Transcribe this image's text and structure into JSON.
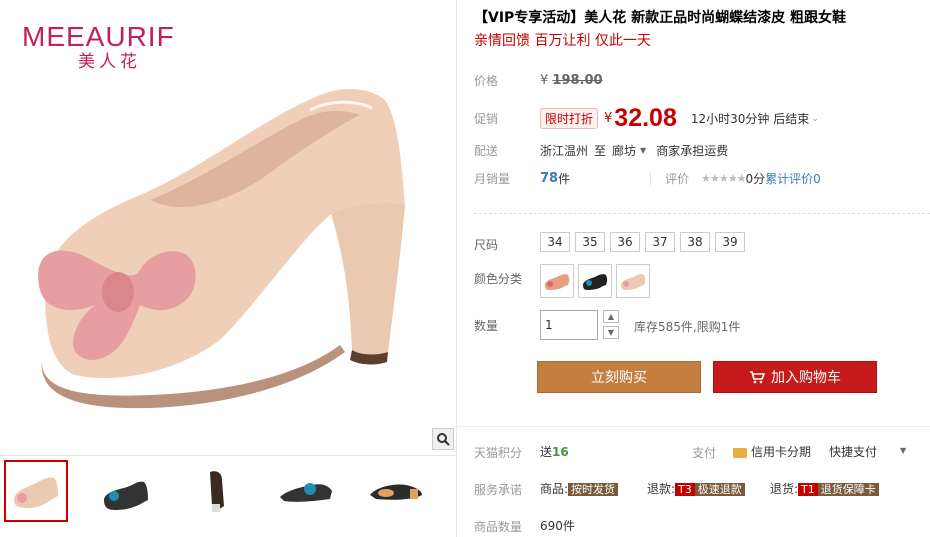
{
  "brand": {
    "name_en": "MEEAURIF",
    "name_cn": "美人花"
  },
  "thumbnails": [
    "thumb-pink-pump",
    "thumb-black-blue-side",
    "thumb-black-back",
    "thumb-blue-side",
    "thumb-sole"
  ],
  "title": "【VIP专享活动】美人花 新款正品时尚蝴蝶结漆皮 粗跟女鞋",
  "subtitle": "亲情回馈 百万让利 仅此一天",
  "price": {
    "label": "价格",
    "currency": "¥",
    "original": "198.00"
  },
  "promo": {
    "label": "促销",
    "tag": "限时打折",
    "currency": "¥",
    "price": "32.08",
    "countdown": "12小时30分钟 后结束"
  },
  "shipping": {
    "label": "配送",
    "from": "浙江温州",
    "to_word": "至",
    "dest": "廊坊",
    "fee": "商家承担运费"
  },
  "monthly": {
    "label": "月销量",
    "count": "78",
    "unit": "件",
    "review_label": "评价",
    "review_count": "0",
    "review_text": "分",
    "cumulative_label": "累计评价",
    "cumulative_count": "0"
  },
  "size": {
    "label": "尺码",
    "options": [
      "34",
      "35",
      "36",
      "37",
      "38",
      "39"
    ]
  },
  "color": {
    "label": "颜色分类",
    "options": [
      "pink",
      "blue",
      "beige"
    ]
  },
  "quantity": {
    "label": "数量",
    "value": "1",
    "stock": "库存585件,限购1件"
  },
  "buttons": {
    "buy": "立刻购买",
    "cart": "加入购物车"
  },
  "tmall_points": {
    "label": "天猫积分",
    "prefix": "送",
    "value": "16"
  },
  "payment": {
    "label": "支付",
    "credit": "信用卡分期",
    "quick": "快捷支付"
  },
  "service": {
    "label": "服务承诺",
    "goods_label": "商品:",
    "goods_badge": "按时发货",
    "refund_label": "退款:",
    "refund_code": "T3",
    "refund_badge": "极速退款",
    "return_label": "退货:",
    "return_code": "T1",
    "return_badge": "退货保障卡"
  },
  "count": {
    "label": "商品数量",
    "value": "690件"
  }
}
